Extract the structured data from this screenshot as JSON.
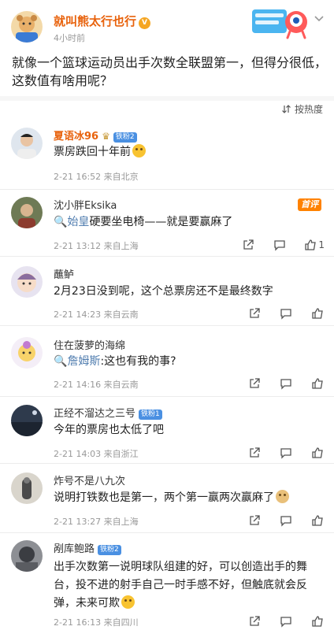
{
  "post": {
    "author": "就叫熊太行也行",
    "time": "4小时前",
    "body": "就像一个篮球运动员出手次数全联盟第一，但得分很低，这数值有啥用呢？"
  },
  "sort": {
    "label": "按热度"
  },
  "comments": [
    {
      "name": "夏语冰96",
      "level": "铁粉2",
      "text": "票房跌回十年前",
      "date": "2-21 16:52",
      "loc": "来自北京",
      "emoji": "laugh-cry"
    },
    {
      "name": "沈小胖Eksika",
      "hot": "首评",
      "mention": "始皇",
      "text": "硬要坐电椅——就是要赢麻了",
      "date": "2-21 13:12",
      "loc": "来自上海",
      "likes": "1"
    },
    {
      "name": "蘸鲈",
      "text": "2月23日没到呢，这个总票房还不是最终数字",
      "date": "2-21 14:23",
      "loc": "来自云南"
    },
    {
      "name": "住在菠萝的海绵",
      "mention": "詹姆斯",
      "text": ":这也有我的事?",
      "date": "2-21 14:16",
      "loc": "来自云南"
    },
    {
      "name": "正经不溜达之三号",
      "level": "铁粉1",
      "text": "今年的票房也太低了吧",
      "date": "2-21 14:03",
      "loc": "来自浙江"
    },
    {
      "name": "炸号不是八九次",
      "text": "说明打铁数也是第一，两个第一赢两次赢麻了",
      "date": "2-21 13:27",
      "loc": "来自上海",
      "emoji": "doge"
    },
    {
      "name": "剐库鲍路",
      "level": "铁粉2",
      "text": "出手次数第一说明球队组建的好，可以创造出手的舞台，投不进的射手自己一时手感不好，但触底就会反弹，未来可欺",
      "date": "2-21 16:13",
      "loc": "来自四川",
      "emoji": "smile"
    }
  ]
}
